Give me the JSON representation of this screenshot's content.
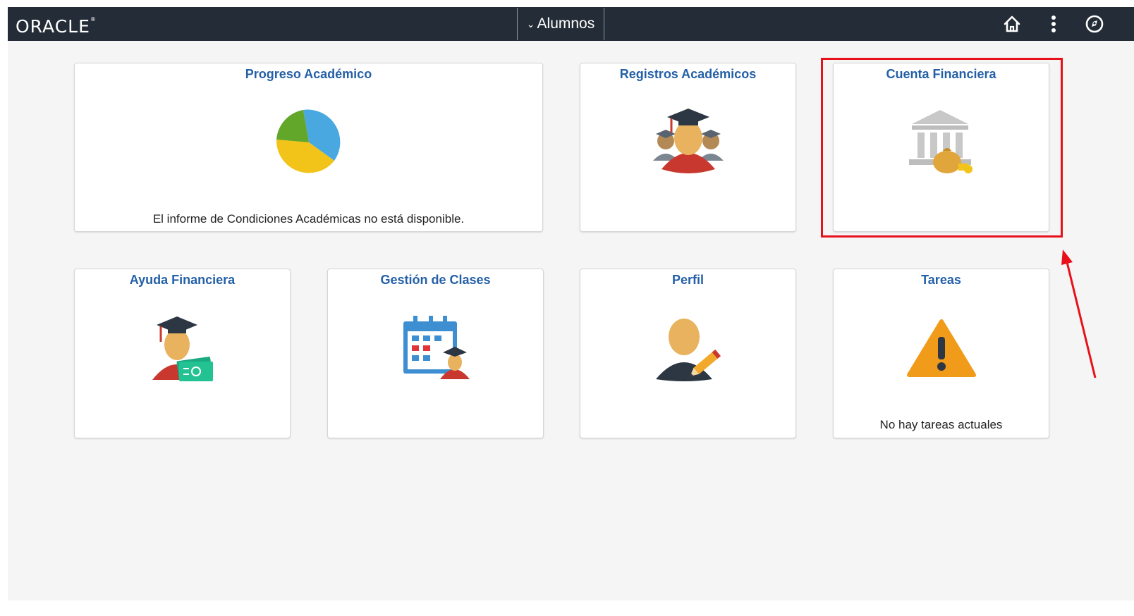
{
  "header": {
    "logo_text": "ORACLE",
    "homepage_label": "Alumnos",
    "icons": [
      "home-icon",
      "actions-menu-icon",
      "navbar-compass-icon"
    ]
  },
  "tiles": {
    "progreso": {
      "title": "Progreso Académico",
      "note": "El informe de Condiciones Académicas no está disponible."
    },
    "registros": {
      "title": "Registros Académicos"
    },
    "cuenta": {
      "title": "Cuenta Financiera"
    },
    "ayuda": {
      "title": "Ayuda Financiera"
    },
    "gestion": {
      "title": "Gestión de Clases"
    },
    "perfil": {
      "title": "Perfil"
    },
    "tareas": {
      "title": "Tareas",
      "note": "No hay tareas actuales"
    }
  },
  "annotation": {
    "color": "#e8101a"
  },
  "colors": {
    "header_bg": "#242d37",
    "tile_title": "#2460a7"
  }
}
